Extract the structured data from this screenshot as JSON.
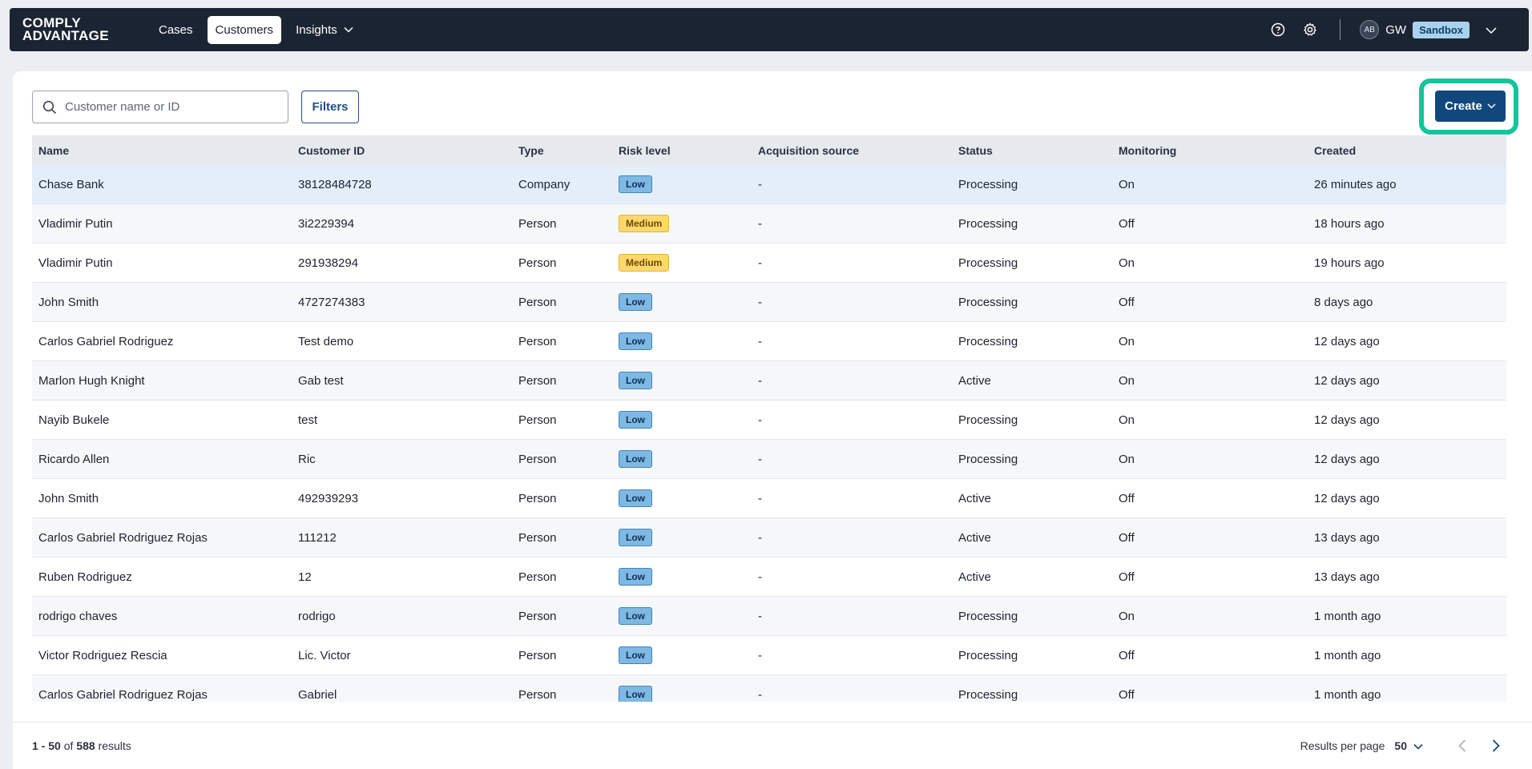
{
  "brand": {
    "line1": "COMPLY",
    "line2": "ADVANTAGE"
  },
  "nav": {
    "cases": "Cases",
    "customers": "Customers",
    "insights": "Insights"
  },
  "user": {
    "avatar": "AB",
    "initials": "GW",
    "environment": "Sandbox"
  },
  "toolbar": {
    "search_placeholder": "Customer name or ID",
    "filters_label": "Filters",
    "create_label": "Create"
  },
  "table": {
    "columns": [
      "Name",
      "Customer ID",
      "Type",
      "Risk level",
      "Acquisition source",
      "Status",
      "Monitoring",
      "Created"
    ],
    "rows": [
      {
        "name": "Chase Bank",
        "id": "38128484728",
        "type": "Company",
        "risk": "Low",
        "acq": "-",
        "status": "Processing",
        "monitoring": "On",
        "created": "26 minutes ago"
      },
      {
        "name": "Vladimir Putin",
        "id": "3i2229394",
        "type": "Person",
        "risk": "Medium",
        "acq": "-",
        "status": "Processing",
        "monitoring": "Off",
        "created": "18 hours ago"
      },
      {
        "name": "Vladimir Putin",
        "id": "291938294",
        "type": "Person",
        "risk": "Medium",
        "acq": "-",
        "status": "Processing",
        "monitoring": "On",
        "created": "19 hours ago"
      },
      {
        "name": "John Smith",
        "id": "4727274383",
        "type": "Person",
        "risk": "Low",
        "acq": "-",
        "status": "Processing",
        "monitoring": "Off",
        "created": "8 days ago"
      },
      {
        "name": "Carlos Gabriel Rodriguez",
        "id": "Test demo",
        "type": "Person",
        "risk": "Low",
        "acq": "-",
        "status": "Processing",
        "monitoring": "On",
        "created": "12 days ago"
      },
      {
        "name": "Marlon Hugh Knight",
        "id": "Gab test",
        "type": "Person",
        "risk": "Low",
        "acq": "-",
        "status": "Active",
        "monitoring": "On",
        "created": "12 days ago"
      },
      {
        "name": "Nayib Bukele",
        "id": "test",
        "type": "Person",
        "risk": "Low",
        "acq": "-",
        "status": "Processing",
        "monitoring": "On",
        "created": "12 days ago"
      },
      {
        "name": "Ricardo Allen",
        "id": "Ric",
        "type": "Person",
        "risk": "Low",
        "acq": "-",
        "status": "Processing",
        "monitoring": "On",
        "created": "12 days ago"
      },
      {
        "name": "John Smith",
        "id": "492939293",
        "type": "Person",
        "risk": "Low",
        "acq": "-",
        "status": "Active",
        "monitoring": "Off",
        "created": "12 days ago"
      },
      {
        "name": "Carlos Gabriel Rodriguez Rojas",
        "id": "111212",
        "type": "Person",
        "risk": "Low",
        "acq": "-",
        "status": "Active",
        "monitoring": "Off",
        "created": "13 days ago"
      },
      {
        "name": "Ruben Rodriguez",
        "id": "12",
        "type": "Person",
        "risk": "Low",
        "acq": "-",
        "status": "Active",
        "monitoring": "Off",
        "created": "13 days ago"
      },
      {
        "name": "rodrigo chaves",
        "id": "rodrigo",
        "type": "Person",
        "risk": "Low",
        "acq": "-",
        "status": "Processing",
        "monitoring": "On",
        "created": "1 month ago"
      },
      {
        "name": "Victor Rodriguez Rescia",
        "id": "Lic. Victor",
        "type": "Person",
        "risk": "Low",
        "acq": "-",
        "status": "Processing",
        "monitoring": "Off",
        "created": "1 month ago"
      },
      {
        "name": "Carlos Gabriel Rodriguez Rojas",
        "id": "Gabriel",
        "type": "Person",
        "risk": "Low",
        "acq": "-",
        "status": "Processing",
        "monitoring": "Off",
        "created": "1 month ago"
      }
    ]
  },
  "footer": {
    "range": "1 - 50",
    "of_text": "of",
    "total": "588",
    "results_text": "results",
    "per_page_label": "Results per page",
    "per_page_value": "50"
  },
  "colors": {
    "nav_bg": "#1b2433",
    "accent": "#10487d",
    "highlight_ring": "#13c59a",
    "risk_low": "#7fb9e3",
    "risk_medium": "#ffd86b"
  },
  "icons": {
    "help": "help-circle-icon",
    "settings": "gear-icon",
    "search": "search-icon",
    "chevron": "chevron-down-icon",
    "prev": "chevron-left-icon",
    "next": "chevron-right-icon"
  }
}
